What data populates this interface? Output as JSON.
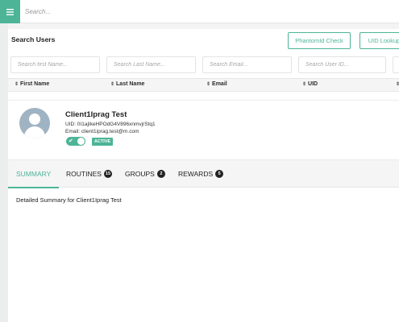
{
  "topbar": {
    "menu_icon": "hamburger-menu-icon",
    "search_placeholder": "Search..."
  },
  "search_users": {
    "title": "Search Users",
    "phantom_button": "PhantomId Check",
    "uid_button": "UID Lookup",
    "filters": {
      "first_name": "Search first Name...",
      "last_name": "Search Last Name...",
      "email": "Search Email...",
      "user_id": "Search User ID...",
      "extra": ""
    },
    "columns": [
      "First Name",
      "Last Name",
      "Email",
      "UID",
      ""
    ]
  },
  "user": {
    "name": "Client1Iprag Test",
    "uid_line": "UID: 0I1ajIkeHPOdG4V896xnmvjrStq1",
    "email_line": "Email: client1iprag.test@m.com",
    "status_badge": "ACTIVE",
    "enabled": true
  },
  "tabs": [
    {
      "label": "SUMMARY",
      "count": null,
      "active": true
    },
    {
      "label": "ROUTINES",
      "count": "15",
      "active": false
    },
    {
      "label": "GROUPS",
      "count": "2",
      "active": false
    },
    {
      "label": "REWARDS",
      "count": "5",
      "active": false
    }
  ],
  "summary": {
    "text": "Detailed Summary for Client1Iprag Test"
  },
  "colors": {
    "accent": "#4db497",
    "avatar_bg": "#9fb3c3"
  }
}
